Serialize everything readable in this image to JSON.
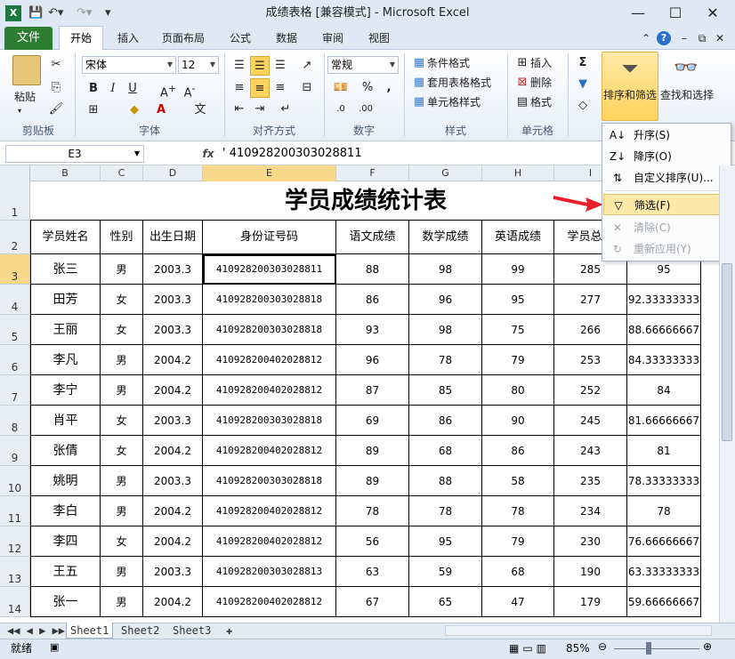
{
  "window": {
    "title": "成绩表格  [兼容模式] - Microsoft Excel",
    "min": "—",
    "max": "☐",
    "close": "✕"
  },
  "tabs": {
    "file": "文件",
    "home": "开始",
    "insert": "插入",
    "layout": "页面布局",
    "formulas": "公式",
    "data": "数据",
    "review": "审阅",
    "view": "视图"
  },
  "ribbon": {
    "paste": "粘贴",
    "font_name": "宋体",
    "font_size": "12",
    "number_format": "常规",
    "cond_format": "条件格式",
    "table_format": "套用表格格式",
    "cell_style": "单元格样式",
    "insert": "插入",
    "delete": "删除",
    "format": "格式",
    "sort_filter": "排序和筛选",
    "find_select": "查找和选择",
    "groups": {
      "clipboard": "剪贴板",
      "font": "字体",
      "align": "对齐方式",
      "number": "数字",
      "style": "样式",
      "cells": "单元格"
    }
  },
  "formula_bar": {
    "name_box": "E3",
    "fx": "fx",
    "content": "' 410928200303028811"
  },
  "sheet": {
    "title": "学员成绩统计表",
    "columns": [
      "B",
      "C",
      "D",
      "E",
      "F",
      "G",
      "H",
      "I"
    ],
    "headers": [
      "学员姓名",
      "性别",
      "出生日期",
      "身份证号码",
      "语文成绩",
      "数学成绩",
      "英语成绩",
      "学员总成"
    ],
    "rows": [
      {
        "n": "3",
        "c": [
          "张三",
          "男",
          "2003.3",
          "410928200303028811",
          "88",
          "98",
          "99",
          "285",
          "95"
        ]
      },
      {
        "n": "4",
        "c": [
          "田芳",
          "女",
          "2003.3",
          "410928200303028818",
          "86",
          "96",
          "95",
          "277",
          "92.33333333"
        ]
      },
      {
        "n": "5",
        "c": [
          "王丽",
          "女",
          "2003.3",
          "410928200303028818",
          "93",
          "98",
          "75",
          "266",
          "88.66666667"
        ]
      },
      {
        "n": "6",
        "c": [
          "李凡",
          "男",
          "2004.2",
          "410928200402028812",
          "96",
          "78",
          "79",
          "253",
          "84.33333333"
        ]
      },
      {
        "n": "7",
        "c": [
          "李宁",
          "男",
          "2004.2",
          "410928200402028812",
          "87",
          "85",
          "80",
          "252",
          "84"
        ]
      },
      {
        "n": "8",
        "c": [
          "肖平",
          "女",
          "2003.3",
          "410928200303028818",
          "69",
          "86",
          "90",
          "245",
          "81.66666667"
        ]
      },
      {
        "n": "9",
        "c": [
          "张倩",
          "女",
          "2004.2",
          "410928200402028812",
          "89",
          "68",
          "86",
          "243",
          "81"
        ]
      },
      {
        "n": "10",
        "c": [
          "姚明",
          "男",
          "2003.3",
          "410928200303028818",
          "89",
          "88",
          "58",
          "235",
          "78.33333333"
        ]
      },
      {
        "n": "11",
        "c": [
          "李白",
          "男",
          "2004.2",
          "410928200402028812",
          "78",
          "78",
          "78",
          "234",
          "78"
        ]
      },
      {
        "n": "12",
        "c": [
          "李四",
          "女",
          "2004.2",
          "410928200402028812",
          "56",
          "95",
          "79",
          "230",
          "76.66666667"
        ]
      },
      {
        "n": "13",
        "c": [
          "王五",
          "男",
          "2003.3",
          "410928200303028813",
          "63",
          "59",
          "68",
          "190",
          "63.33333333"
        ]
      },
      {
        "n": "14",
        "c": [
          "张一",
          "男",
          "2004.2",
          "410928200402028812",
          "67",
          "65",
          "47",
          "179",
          "59.66666667"
        ]
      }
    ]
  },
  "menu": {
    "asc": "升序(S)",
    "desc": "降序(O)",
    "custom": "自定义排序(U)...",
    "filter": "筛选(F)",
    "clear": "清除(C)",
    "reapply": "重新应用(Y)"
  },
  "sheet_tabs": [
    "Sheet1",
    "Sheet2",
    "Sheet3"
  ],
  "status": {
    "ready": "就绪",
    "zoom": "85%"
  },
  "colors": {
    "file_tab": "#2d7d32",
    "highlight": "#fde9a8",
    "arrow": "#e8202a"
  }
}
